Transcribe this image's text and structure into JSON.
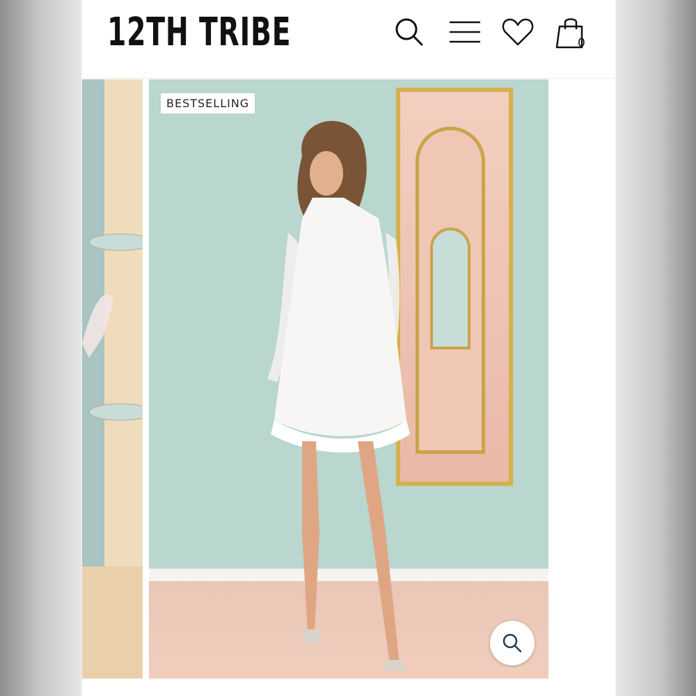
{
  "header": {
    "brand": "12TH TRIBE",
    "cart_count": "0"
  },
  "icons": {
    "search": "search-icon",
    "menu": "hamburger-menu-icon",
    "wishlist": "heart-icon",
    "cart": "shopping-bag-icon",
    "zoom": "zoom-icon"
  },
  "gallery": {
    "badge": "BESTSELLING"
  },
  "colors": {
    "wall": "#b9d6cf",
    "mirror_frame": "#d6b04c",
    "floor": "#f0cdbd"
  }
}
